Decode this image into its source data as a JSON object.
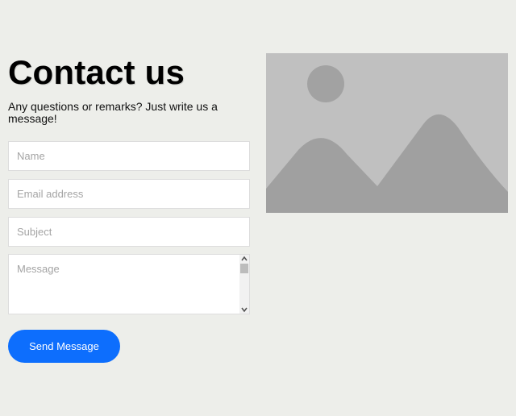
{
  "header": {
    "title": "Contact us",
    "subtitle": "Any questions or remarks? Just write us a message!"
  },
  "form": {
    "name_placeholder": "Name",
    "email_placeholder": "Email address",
    "subject_placeholder": "Subject",
    "message_placeholder": "Message",
    "name_value": "",
    "email_value": "",
    "subject_value": "",
    "message_value": "",
    "submit_label": "Send Message"
  },
  "scrollbar": {
    "up_icon": "▲",
    "down_icon": "▼"
  },
  "image": {
    "icon": "image-placeholder-icon"
  },
  "colors": {
    "background": "#edeeea",
    "accent": "#0d6efd",
    "placeholder_bg": "#c0c0c0",
    "placeholder_shape": "#a0a0a0"
  }
}
